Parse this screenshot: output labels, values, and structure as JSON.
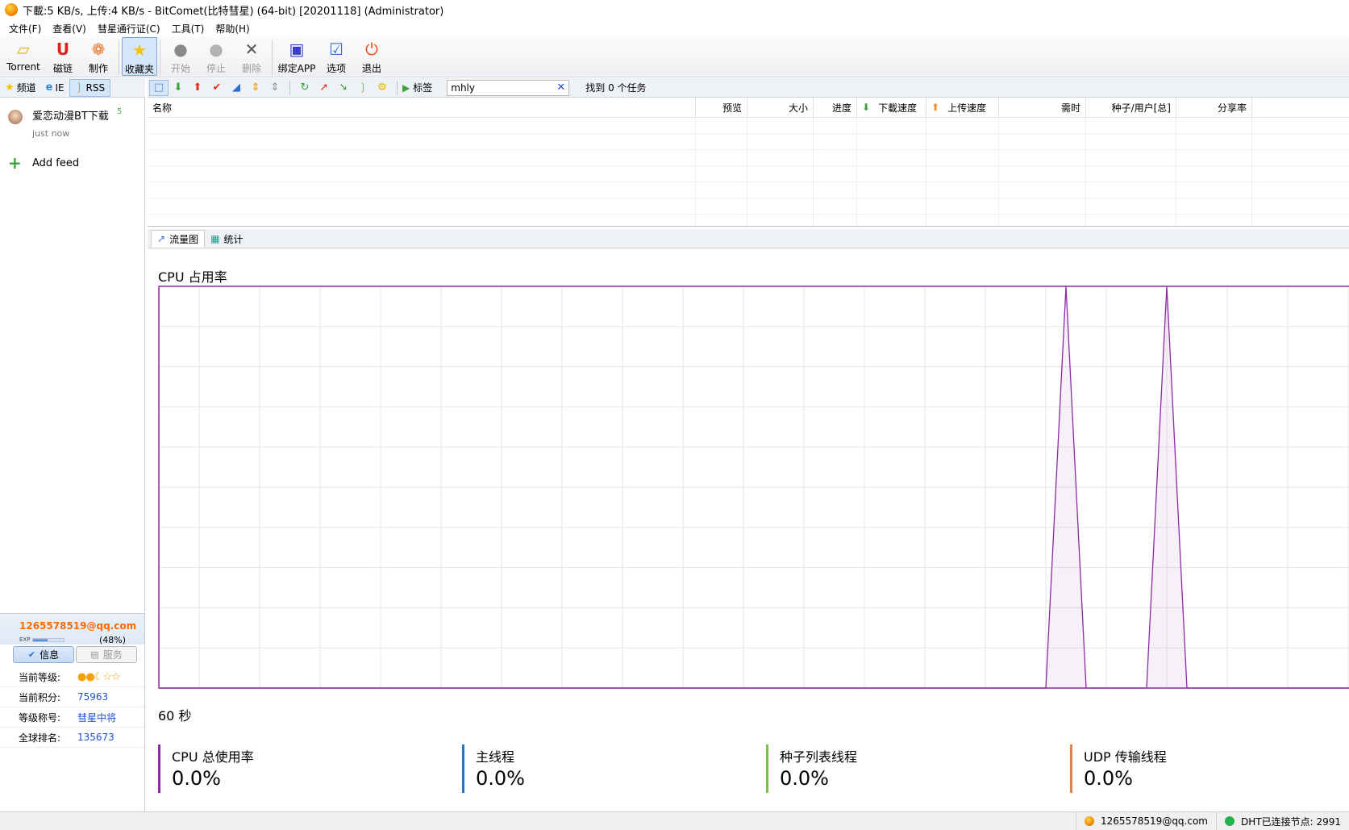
{
  "window": {
    "title": "下載:5 KB/s, 上传:4 KB/s - BitComet(比特彗星) (64-bit) [20201118] (Administrator)"
  },
  "menu": [
    "文件(F)",
    "查看(V)",
    "彗星通行证(C)",
    "工具(T)",
    "帮助(H)"
  ],
  "toolbar": {
    "torrent": "Torrent",
    "magnet": "磁链",
    "make": "制作",
    "favorites": "收藏夹",
    "start": "开始",
    "stop": "停止",
    "delete": "删除",
    "bind_app": "绑定APP",
    "options": "选项",
    "exit": "退出"
  },
  "sidebar": {
    "tabs": [
      "频道",
      "IE",
      "RSS"
    ],
    "feed": {
      "name": "爱恋动漫BT下载",
      "count": "5",
      "time": "just now"
    },
    "add_feed": "Add feed"
  },
  "user": {
    "email": "1265578519@qq.com",
    "exp_label": "EXP",
    "exp_percent": "(48%)",
    "exp_fraction": 0.48,
    "tabs": {
      "info": "信息",
      "service": "服务"
    },
    "rows": [
      {
        "key": "当前等级:",
        "value": ""
      },
      {
        "key": "当前积分:",
        "value": "75963"
      },
      {
        "key": "等级称号:",
        "value": "彗星中将"
      },
      {
        "key": "全球排名:",
        "value": "135673"
      }
    ]
  },
  "task_toolbar": {
    "tag_label": "标签",
    "search_value": "mhly",
    "found_text": "找到 0 个任务"
  },
  "table": {
    "columns": [
      "名称",
      "预览",
      "大小",
      "进度",
      "下載速度",
      "上传速度",
      "需时",
      "种子/用户[总]",
      "分享率"
    ]
  },
  "graph_tabs": [
    "流量图",
    "统计"
  ],
  "graph": {
    "title": "CPU 占用率",
    "xlabel": "60 秒",
    "legend": [
      {
        "name": "CPU 总使用率",
        "value": "0.0%",
        "color": "#8c2aa6"
      },
      {
        "name": "主线程",
        "value": "0.0%",
        "color": "#1f77c9"
      },
      {
        "name": "种子列表线程",
        "value": "0.0%",
        "color": "#7cc242"
      },
      {
        "name": "UDP 传输线程",
        "value": "0.0%",
        "color": "#e8823a"
      }
    ]
  },
  "chart_data": {
    "type": "area",
    "title": "CPU 占用率",
    "xlabel": "60 秒",
    "ylabel": "",
    "ylim": [
      0,
      100
    ],
    "grid": true,
    "series": [
      {
        "name": "CPU 总使用率",
        "x": [
          0,
          44,
          45,
          46,
          47,
          48,
          49,
          50,
          51,
          52,
          60
        ],
        "values": [
          0,
          0,
          100,
          0,
          0,
          0,
          0,
          100,
          0,
          0,
          0
        ]
      }
    ]
  },
  "status": {
    "account": "1265578519@qq.com",
    "dht": "DHT已连接节点: 2991"
  },
  "colors": {
    "accent": "#8c2aa6",
    "email": "#ff6a00",
    "link": "#1f4fd6"
  }
}
